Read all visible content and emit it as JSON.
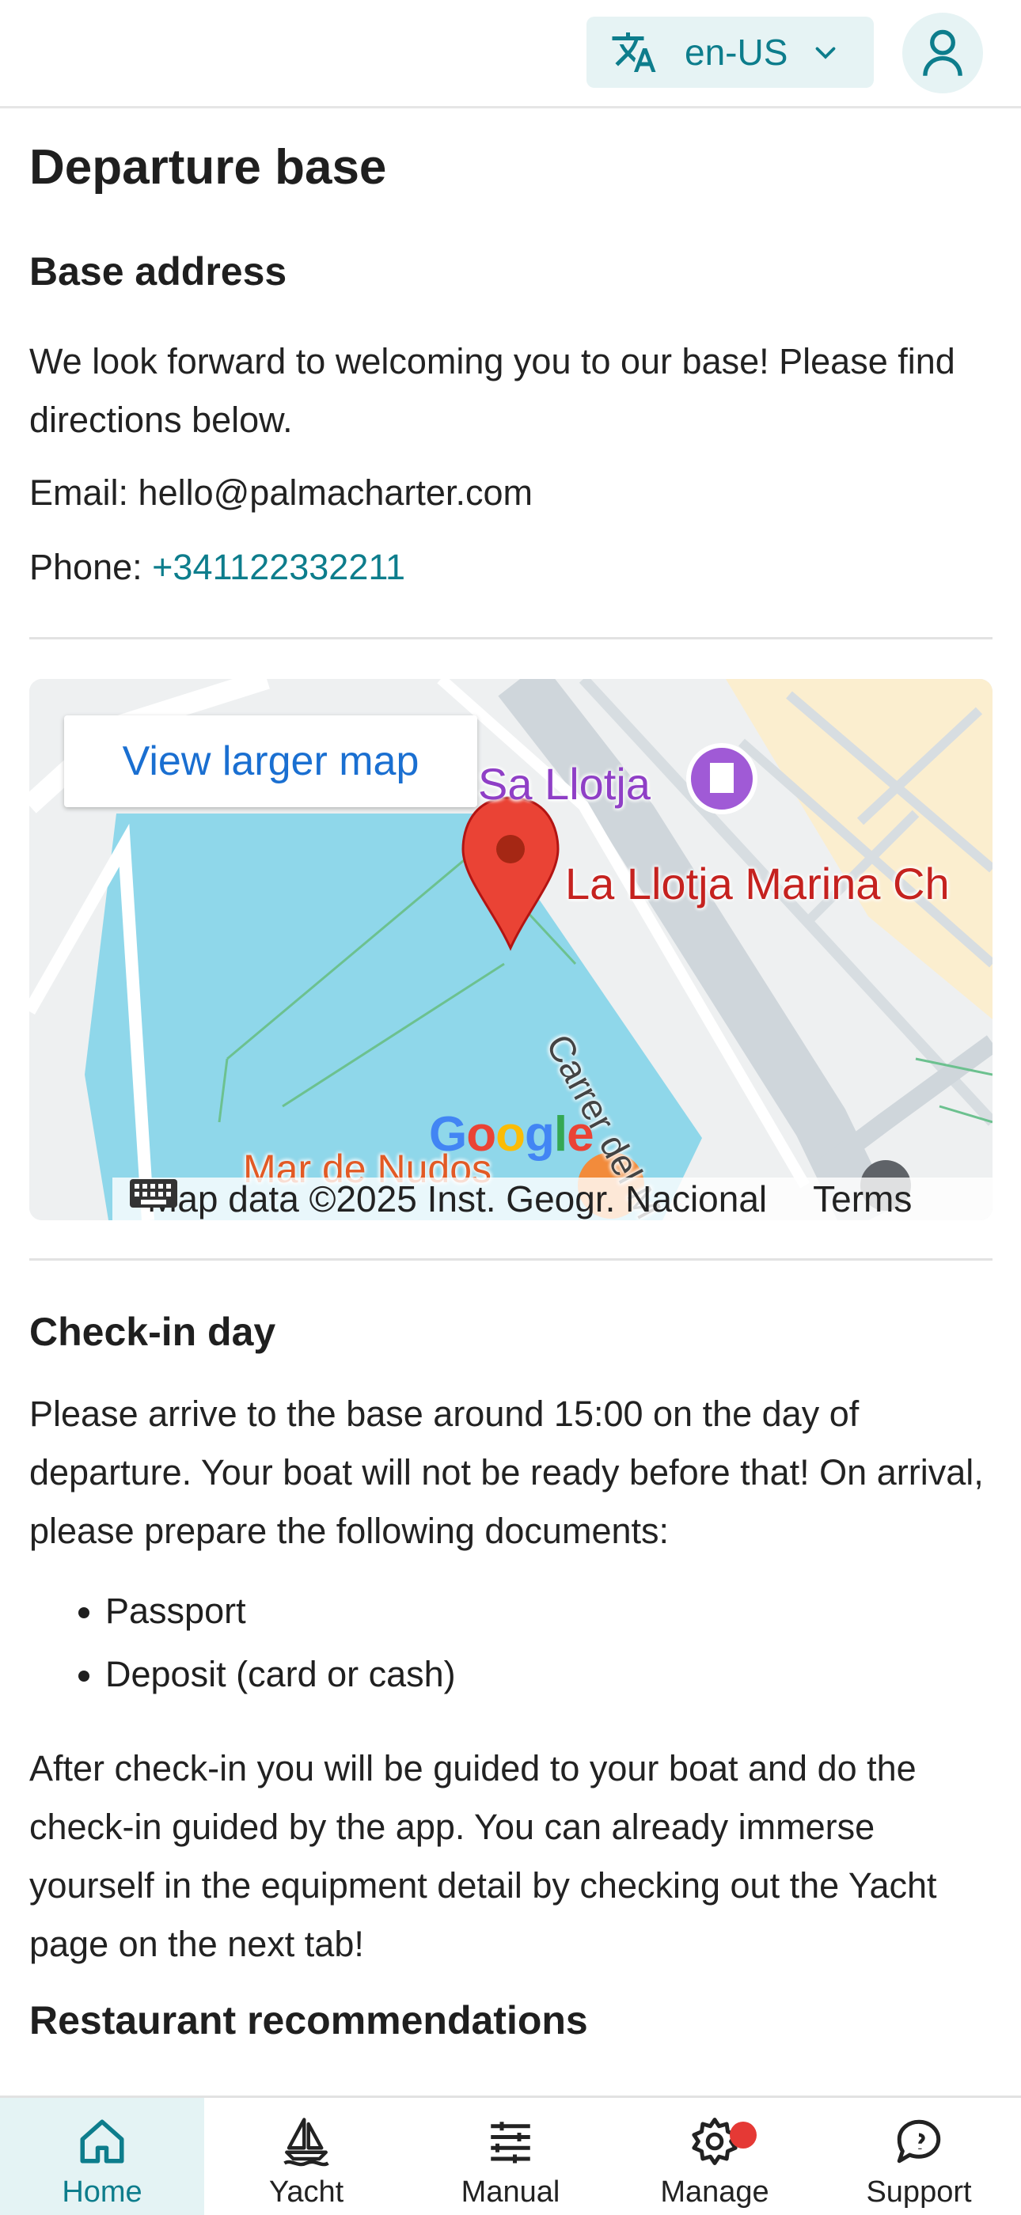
{
  "header": {
    "language": "en-US",
    "icons": [
      "translate-icon",
      "chevron-down-icon",
      "user-icon"
    ]
  },
  "page": {
    "title": "Departure base"
  },
  "address": {
    "heading": "Base address",
    "intro": "We look forward to welcoming you to our base! Please find directions below.",
    "email_label": "Email:",
    "email": "hello@palmacharter.com",
    "phone_label": "Phone:",
    "phone": "+341122332211"
  },
  "map": {
    "button_label": "View larger map",
    "poi_1": "Sa Llotja",
    "poi_2": "La Llotja Marina Ch",
    "poi_3": "Mar de Nudos",
    "street": "Carrer del M",
    "logo": "Google",
    "attribution": "Map data ©2025 Inst. Geogr. Nacional",
    "terms": "Terms"
  },
  "checkin": {
    "heading": "Check-in day",
    "text": "Please arrive to the base around 15:00 on the day of departure. Your boat will not be ready before that! On arrival, please prepare the following documents:",
    "documents": [
      "Passport",
      "Deposit (card or cash)"
    ],
    "after": "After check-in you will be guided to your boat and do the check-in guided by the app. You can already immerse yourself in the equipment detail by checking out the Yacht page on the next tab!"
  },
  "restaurants": {
    "heading": "Restaurant recommendations"
  },
  "nav": {
    "items": [
      {
        "label": "Home",
        "icon": "home-icon",
        "active": true
      },
      {
        "label": "Yacht",
        "icon": "sailboat-icon",
        "active": false
      },
      {
        "label": "Manual",
        "icon": "manual-icon",
        "active": false
      },
      {
        "label": "Manage",
        "icon": "gear-icon",
        "active": false,
        "badge": true
      },
      {
        "label": "Support",
        "icon": "chat-icon",
        "active": false
      }
    ]
  },
  "colors": {
    "accent": "#0d7d8c",
    "accent_bg": "#e4f3f4",
    "water": "#8fd7ea",
    "pin": "#ea4335"
  }
}
